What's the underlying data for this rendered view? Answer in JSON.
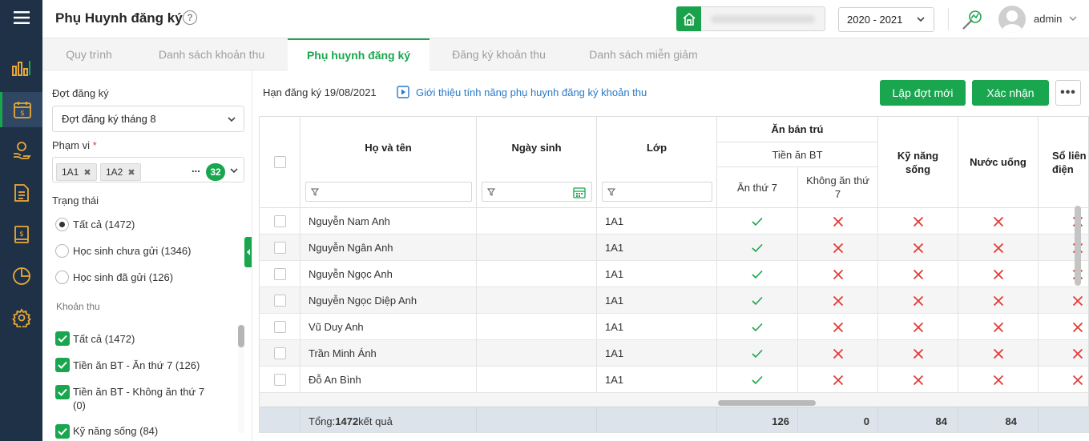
{
  "header": {
    "title": "Phụ Huynh đăng ký",
    "help_icon": "question-circle-icon",
    "school_name": "",
    "year_select": "2020 - 2021",
    "user": "admin"
  },
  "nav": {
    "icons": [
      "menu-icon",
      "chart-bar-icon",
      "calendar-money-icon",
      "hand-coin-icon",
      "document-icon",
      "book-money-icon",
      "pie-chart-icon",
      "gear-icon"
    ]
  },
  "tabs": [
    {
      "label": "Quy trình"
    },
    {
      "label": "Danh sách khoản thu"
    },
    {
      "label": "Phụ huynh đăng ký",
      "active": true
    },
    {
      "label": "Đăng ký khoản thu"
    },
    {
      "label": "Danh sách miễn giảm"
    }
  ],
  "filters": {
    "period_label": "Đợt đăng ký",
    "period_value": "Đợt đăng ký tháng 8",
    "scope_label": "Phạm vi",
    "required_mark": "*",
    "scope_chips": [
      "1A1",
      "1A2"
    ],
    "scope_more": "...",
    "scope_count": "32",
    "status_label": "Trạng thái",
    "status_options": [
      {
        "label": "Tất cả (1472)",
        "selected": true
      },
      {
        "label": "Học sinh chưa gửi (1346)",
        "selected": false
      },
      {
        "label": "Học sinh đã gửi (126)",
        "selected": false
      }
    ],
    "fees_label": "Khoản thu",
    "fee_options": [
      {
        "label": "Tất cả (1472)"
      },
      {
        "label": "Tiền ăn BT - Ăn thứ 7 (126)"
      },
      {
        "label": "Tiền ăn BT - Không ăn thứ 7 (0)"
      },
      {
        "label": "Kỹ năng sống (84)"
      }
    ]
  },
  "toolbar": {
    "deadline": "Hạn đăng ký 19/08/2021",
    "intro_link": "Giới thiệu tính năng phụ huynh đăng ký khoản thu",
    "new_button": "Lập đợt mới",
    "confirm_button": "Xác nhận",
    "more_button": "•••"
  },
  "table": {
    "headers": {
      "name": "Họ và tên",
      "dob": "Ngày sinh",
      "class": "Lớp",
      "group": "Ăn bán trú",
      "subgroup": "Tiền ăn BT",
      "sat": "Ăn thứ 7",
      "nosat": "Không ăn thứ 7",
      "skills": "Kỹ năng sống",
      "water": "Nước uống",
      "contact": "Sổ liên điện"
    },
    "rows": [
      {
        "name": "Nguyễn Nam Anh",
        "dob": "",
        "class": "1A1",
        "sat": true,
        "nosat": false,
        "skills": false,
        "water": false,
        "contact": false
      },
      {
        "name": "Nguyễn Ngân Anh",
        "dob": "",
        "class": "1A1",
        "sat": true,
        "nosat": false,
        "skills": false,
        "water": false,
        "contact": false
      },
      {
        "name": "Nguyễn Ngọc Anh",
        "dob": "",
        "class": "1A1",
        "sat": true,
        "nosat": false,
        "skills": false,
        "water": false,
        "contact": false
      },
      {
        "name": "Nguyễn Ngọc Diệp Anh",
        "dob": "",
        "class": "1A1",
        "sat": true,
        "nosat": false,
        "skills": false,
        "water": false,
        "contact": false
      },
      {
        "name": "Vũ Duy Anh",
        "dob": "",
        "class": "1A1",
        "sat": true,
        "nosat": false,
        "skills": false,
        "water": false,
        "contact": false
      },
      {
        "name": "Trần Minh Ánh",
        "dob": "",
        "class": "1A1",
        "sat": true,
        "nosat": false,
        "skills": false,
        "water": false,
        "contact": false
      },
      {
        "name": "Đỗ An Bình",
        "dob": "",
        "class": "1A1",
        "sat": true,
        "nosat": false,
        "skills": false,
        "water": false,
        "contact": false
      }
    ],
    "footer": {
      "total_prefix": "Tổng: ",
      "total_count": "1472",
      "total_suffix": " kết quả",
      "sat_total": "126",
      "nosat_total": "0",
      "skills_total": "84",
      "water_total": "84"
    }
  },
  "colors": {
    "accent": "#19a64e",
    "sidebar": "#1f3146",
    "check": "#19a64e",
    "cross": "#e53935",
    "link": "#2979c8"
  }
}
